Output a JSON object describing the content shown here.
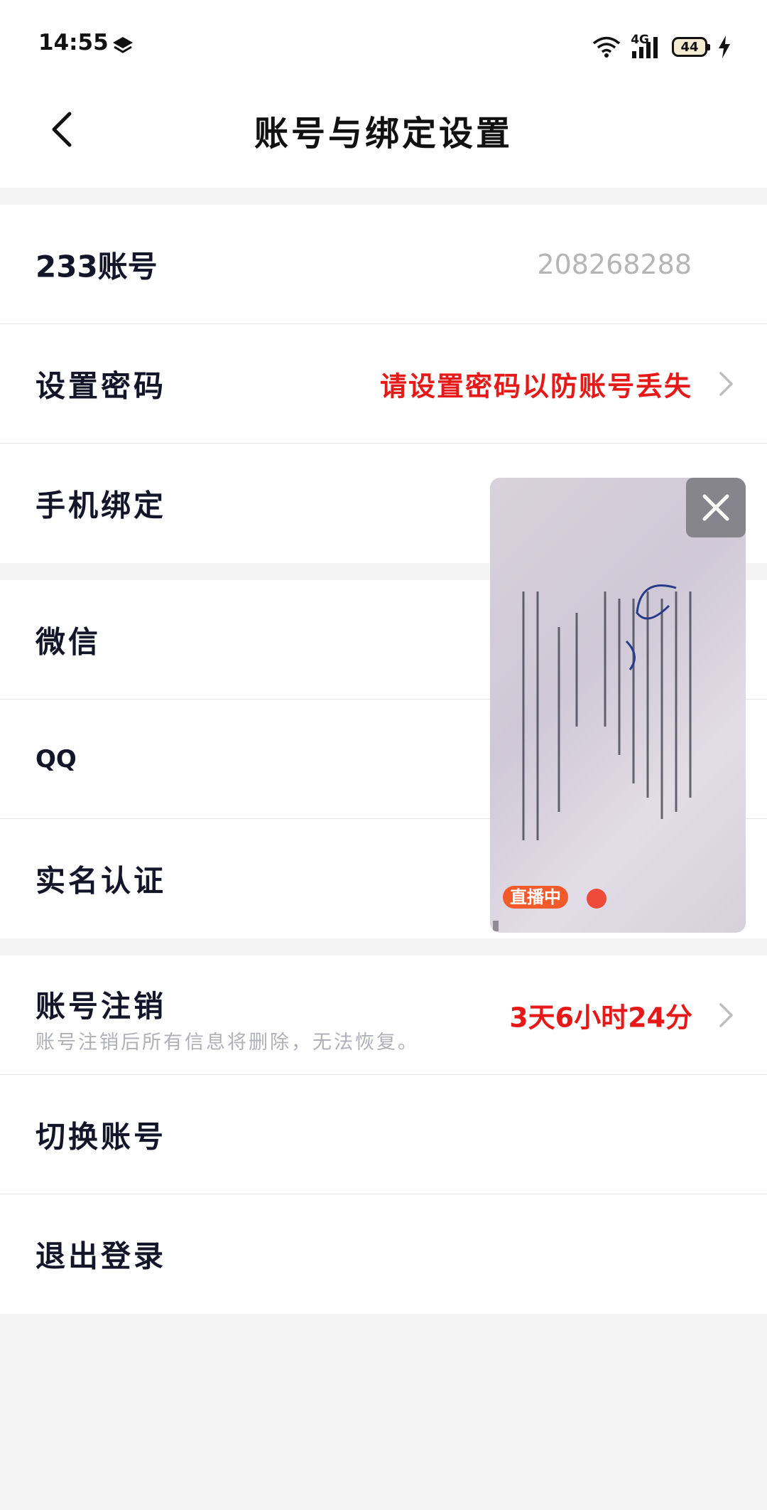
{
  "status_bar": {
    "time": "14:55",
    "network": "4G",
    "battery": "44"
  },
  "header": {
    "title": "账号与绑定设置"
  },
  "account_section": {
    "account_id_label": "233账号",
    "account_id_value": "208268288",
    "password_label": "设置密码",
    "password_hint": "请设置密码以防账号丢失",
    "phone_label": "手机绑定"
  },
  "social_section": {
    "wechat_label": "微信",
    "qq_label": "QQ",
    "realname_label": "实名认证"
  },
  "manage_section": {
    "cancel_label": "账号注销",
    "cancel_sub": "账号注销后所有信息将删除，无法恢复。",
    "cancel_countdown": "3天6小时24分",
    "switch_label": "切换账号",
    "logout_label": "退出登录"
  },
  "pip": {
    "live_badge": "直播中"
  },
  "colors": {
    "accent_red": "#e61919",
    "live_orange": "#f25a2c",
    "background": "#f4f4f4"
  }
}
